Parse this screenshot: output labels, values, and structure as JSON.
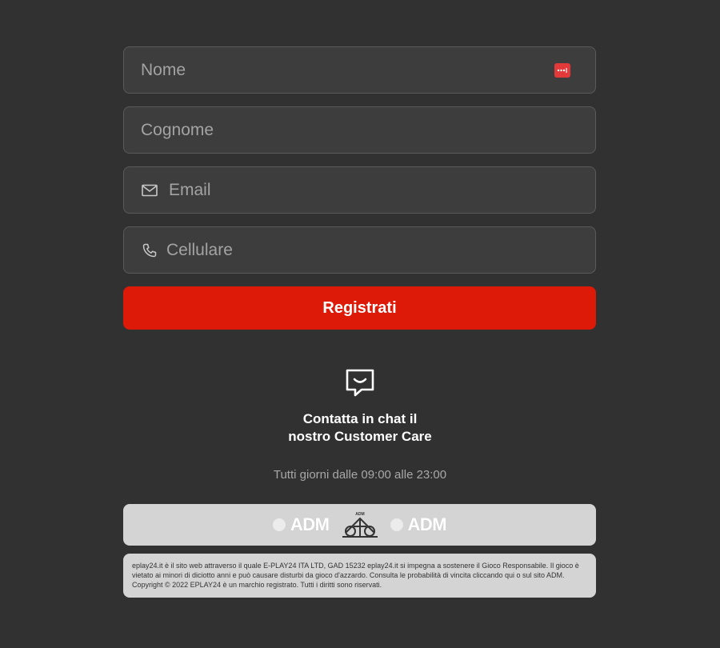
{
  "form": {
    "nome_placeholder": "Nome",
    "cognome_placeholder": "Cognome",
    "email_placeholder": "Email",
    "cellulare_placeholder": "Cellulare",
    "submit_label": "Registrati"
  },
  "support": {
    "chat_line1": "Contatta in chat il",
    "chat_line2": "nostro Customer Care",
    "hours": "Tutti giorni dalle 09:00 alle 23:00"
  },
  "footer": {
    "adm_label_1": "ADM",
    "adm_emblem_label": "ADM",
    "adm_label_2": "ADM",
    "legal_text": "eplay24.it è il sito web attraverso il quale E-PLAY24 ITA LTD, GAD 15232 eplay24.it si impegna a sostenere il Gioco Responsabile. Il gioco è vietato ai minori di diciotto anni e può causare disturbi da gioco d'azzardo. Consulta le probabilità di vincita cliccando qui o sul sito ADM. Copyright © 2022 EPLAY24 è un marchio registrato. Tutti i diritti sono riservati."
  },
  "colors": {
    "background": "#313131",
    "field_bg": "#3d3d3d",
    "accent_red": "#dd1a07",
    "footer_bg": "#d4d4d4"
  },
  "icons": {
    "email": "mail-icon",
    "phone": "phone-icon",
    "chat": "chat-icon",
    "autofill": "autofill-icon"
  }
}
